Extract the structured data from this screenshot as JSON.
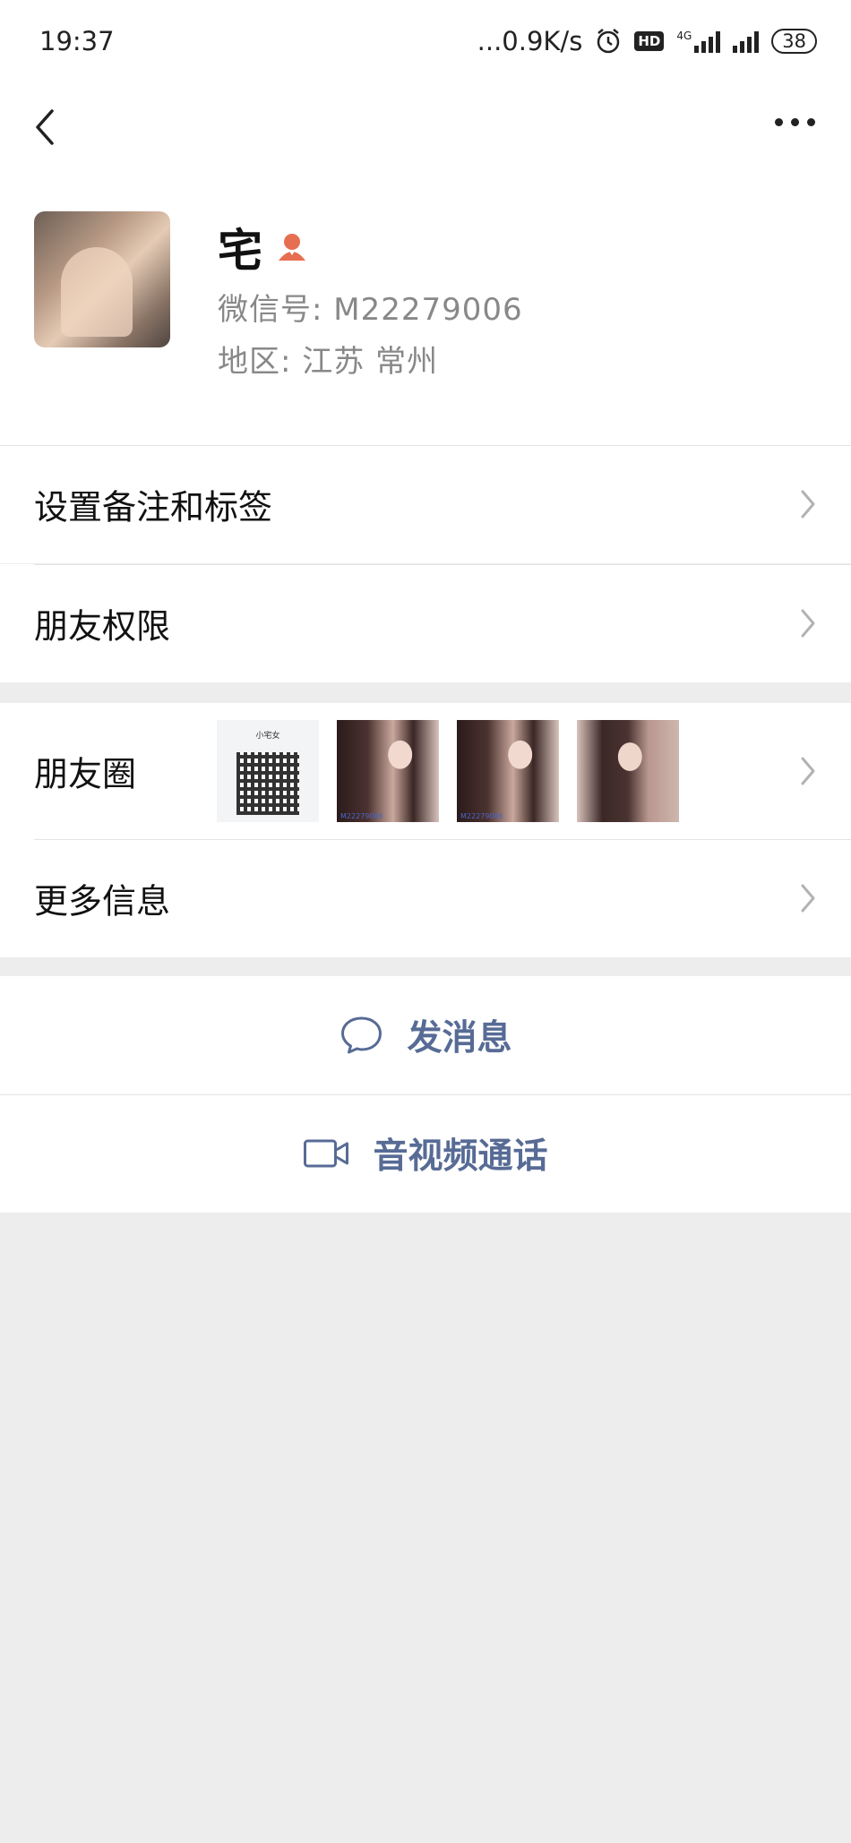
{
  "status_bar": {
    "time": "19:37",
    "network_speed": "...0.9K/s",
    "hd_badge": "HD",
    "net_type": "4G",
    "battery": "38",
    "icons": [
      "alarm-icon",
      "hd-icon",
      "signal-icon",
      "signal-icon",
      "battery-icon"
    ]
  },
  "nav": {
    "back_icon": "chevron-left-icon",
    "more_icon": "more-dots-icon"
  },
  "profile": {
    "name": "宅",
    "gender_icon": "female-icon",
    "wechat_id": "微信号:  M22279006",
    "region": "地区:  江苏  常州"
  },
  "menu": {
    "remark_tags": "设置备注和标签",
    "friend_permissions": "朋友权限",
    "moments": "朋友圈",
    "more_info": "更多信息"
  },
  "moments_thumbs": [
    {
      "kind": "qr",
      "title": "小宅女",
      "caption": ""
    },
    {
      "kind": "photo",
      "caption": "M22279006"
    },
    {
      "kind": "photo",
      "caption": "M22279006"
    },
    {
      "kind": "photo2",
      "caption": ""
    }
  ],
  "actions": {
    "send_message": "发消息",
    "video_call": "音视频通话"
  },
  "colors": {
    "link_blue": "#576b95",
    "page_bg": "#ededed",
    "female_icon": "#e76f51"
  }
}
